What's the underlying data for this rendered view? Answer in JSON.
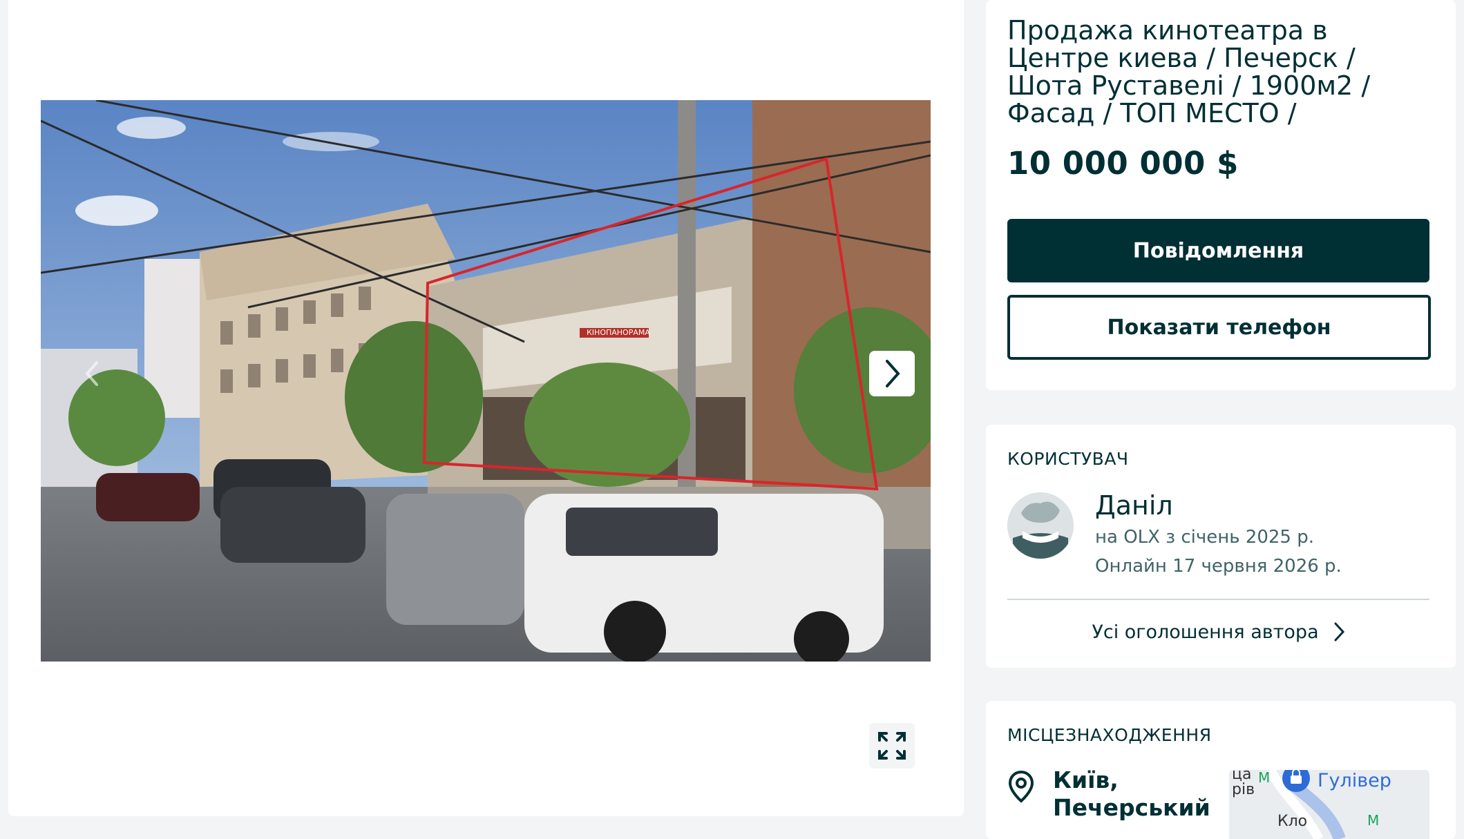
{
  "gallery": {
    "next_icon": "chevron-right-icon",
    "prev_icon": "chevron-left-icon",
    "fullscreen_icon": "expand-icon",
    "image": {
      "subject": "Street view of building facade with cinema, red outline",
      "shop_sign_text": "КІНОПАНОРАМА"
    }
  },
  "listing": {
    "title": "Продажа кинотеатра в Центре киева / Печерск / Шота Руставелі / 1900м2 / Фасад / ТОП МЕСТО /",
    "price": "10 000 000 $",
    "message_button": "Повідомлення",
    "phone_button": "Показати телефон"
  },
  "user": {
    "section_label": "КОРИСТУВАЧ",
    "name": "Даніл",
    "since": "на OLX з січень 2025 р.",
    "online": "Онлайн 17 червня 2026 р.",
    "all_ads_link": "Усі оголошення автора"
  },
  "location": {
    "section_label": "МІСЦЕЗНАХОДЖЕННЯ",
    "city": "Київ,",
    "district": "Печерський",
    "map_labels": {
      "poi": "Гулівер",
      "partial_top_left": "ца",
      "partial_second": "рів",
      "partial_bottom": "Кло"
    }
  },
  "colors": {
    "primary": "#002f34",
    "muted_text": "#406367",
    "background": "#f2f4f5",
    "map_link": "#2f6bd8"
  }
}
